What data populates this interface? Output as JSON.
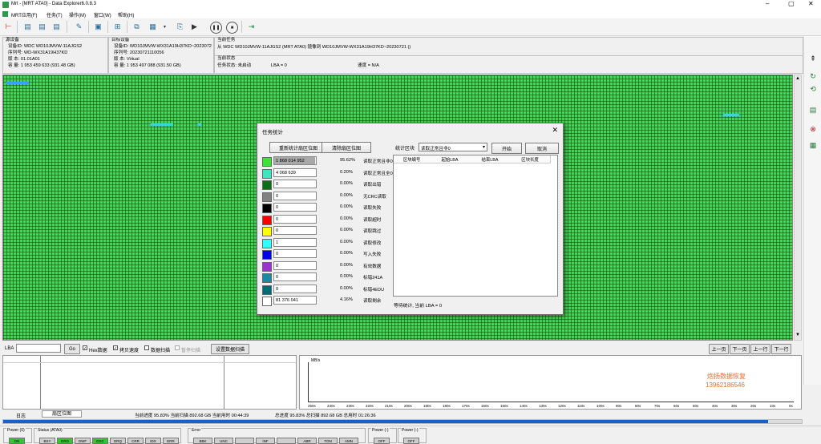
{
  "window": {
    "title": "Mrt - [MRT ATA0] - Data Explorer6.0.8.3",
    "app_icon": "app-logo-icon"
  },
  "menu": [
    "MRT应用(F)",
    "任务(T)",
    "操作(M)",
    "窗口(W)",
    "帮助(H)"
  ],
  "source": {
    "group_title": "源设备",
    "id": "设备ID: WDC WD10JMVW-11AJGS2",
    "serial": "序列号: WD-WX31A19H37KD",
    "version": "版    本: 01.01A01",
    "capacity": "容    量: 1 953 459 633 (931.48 GB)"
  },
  "target": {
    "group_title": "目标设备",
    "id": "设备ID: WD10JMVW-WX31A19H37KD~2023072",
    "serial": "序列号: 20230721110056",
    "version": "版    本: Virtual",
    "capacity": "容    量: 1 953 497 088 (931.50 GB)"
  },
  "task": {
    "group_title": "当前任务",
    "description": "从 WDC WD10JMVW-11AJGS2 (MRT ATA0) 镜像到 WD10JMVW-WX31A19H37KD~20230721 ()",
    "status_title": "当前状态",
    "state": "任务状态: 未启动",
    "lba": "LBA = 0",
    "speed": "速度 = N/A"
  },
  "lba_bar": {
    "label": "LBA",
    "input_value": "",
    "go": "Go",
    "hex": "Hex数据",
    "copy_speed": "拷贝速度",
    "data_scan": "数据扫描",
    "pause_scan": "暂停扫描",
    "settings": "设置数据扫描",
    "prev_page": "上一页",
    "next_page": "下一页",
    "prev_row": "上一行",
    "next_row": "下一行"
  },
  "speed_chart": {
    "ylabel": "MB/s",
    "watermark_name": "炮扬数据恢复",
    "watermark_phone": "13962186546",
    "ticks": [
      "250s",
      "240s",
      "230s",
      "220s",
      "210s",
      "200s",
      "190s",
      "180s",
      "170s",
      "160s",
      "150s",
      "140s",
      "130s",
      "120s",
      "110s",
      "100s",
      "90s",
      "80s",
      "70s",
      "60s",
      "50s",
      "40s",
      "30s",
      "20s",
      "10s",
      "0s"
    ]
  },
  "bottom_tabs": [
    "日志",
    "扇区位图"
  ],
  "progress": {
    "current": "当前进度 95.83% 当前扫描 892.68 GB 当前用时 00:44:39",
    "total": "总进度 95.83% 总扫描 892.68 GB 总用时 01:26:36",
    "fraction": 0.958
  },
  "status": {
    "power0": "Power (0)",
    "power0_led": "ON",
    "status_title": "Status (ATA0)",
    "status_leds": [
      "BSY",
      "DRD",
      "DWF",
      "DSC",
      "DRQ",
      "CRR",
      "IDX",
      "ERR"
    ],
    "error_title": "Error",
    "error_leds": [
      "BBK",
      "UNC",
      "",
      "INF",
      "",
      "ABR",
      "TON",
      "AMN"
    ],
    "power1": "Power (-)",
    "power1_led": "OFF",
    "power2": "Power (-)",
    "power2_led": "OFF"
  },
  "dialog": {
    "title": "任务统计",
    "btn_redraw": "重新统计扇区位图",
    "btn_clear": "清除扇区位图",
    "stat_label": "统计区块",
    "stat_select": "读取正常且非0",
    "btn_start": "开始",
    "btn_cancel": "取消",
    "table_headers": [
      "区块编号",
      "起始LBA",
      "结束LBA",
      "区块长度"
    ],
    "wait_text": "等待统计, 当前 LBA = 0",
    "rows": [
      {
        "value": "1 868 014 952",
        "pct": "95.62%",
        "label": "读取正常且非0",
        "color": "#39e439",
        "bar": 0.9562
      },
      {
        "value": "4 068 639",
        "pct": "0.20%",
        "label": "读取正常且全0",
        "color": "#3ee6c0",
        "bar": 0.002
      },
      {
        "value": "0",
        "pct": "0.00%",
        "label": "读取出错",
        "color": "#0f6d14",
        "bar": 0
      },
      {
        "value": "0",
        "pct": "0.00%",
        "label": "无CRC读取",
        "color": "#808080",
        "bar": 0
      },
      {
        "value": "0",
        "pct": "0.00%",
        "label": "读取失败",
        "color": "#000000",
        "bar": 0
      },
      {
        "value": "0",
        "pct": "0.00%",
        "label": "读取超时",
        "color": "#ff0000",
        "bar": 0
      },
      {
        "value": "0",
        "pct": "0.00%",
        "label": "读取跳过",
        "color": "#ffff00",
        "bar": 0
      },
      {
        "value": "1",
        "pct": "0.00%",
        "label": "读取修改",
        "color": "#30ffff",
        "bar": 0
      },
      {
        "value": "0",
        "pct": "0.00%",
        "label": "写入失败",
        "color": "#0000ee",
        "bar": 0
      },
      {
        "value": "0",
        "pct": "0.00%",
        "label": "有效数据",
        "color": "#9933cc",
        "bar": 0
      },
      {
        "value": "0",
        "pct": "0.00%",
        "label": "标错241A",
        "color": "#1b8aa0",
        "bar": 0
      },
      {
        "value": "0",
        "pct": "0.00%",
        "label": "标错4EDU",
        "color": "#006a74",
        "bar": 0
      },
      {
        "value": "81 376 041",
        "pct": "4.16%",
        "label": "读取剩余",
        "color": "#ffffff",
        "bar": 0.0416
      }
    ]
  }
}
